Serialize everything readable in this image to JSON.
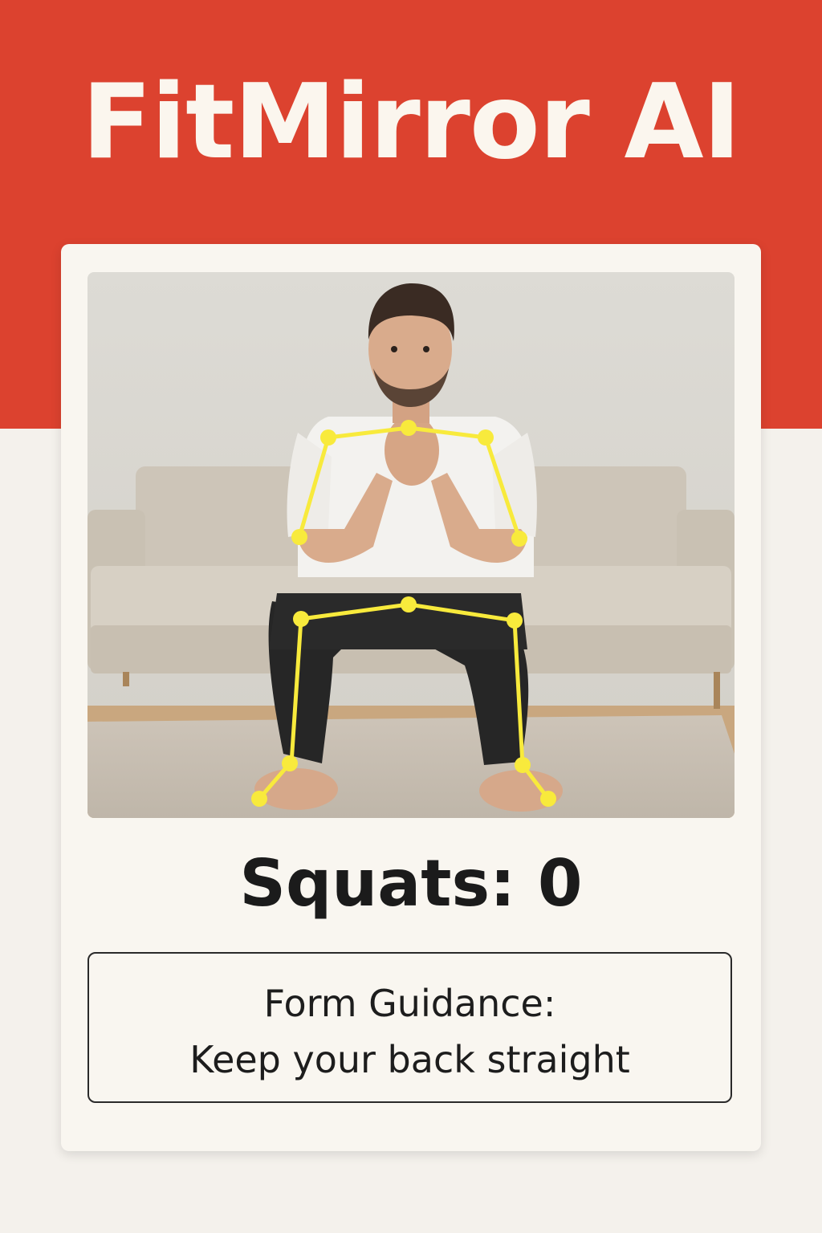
{
  "app": {
    "title": "FitMirror AI"
  },
  "exercise": {
    "counter_label": "Squats: 0",
    "name": "Squats",
    "reps": 0
  },
  "guidance": {
    "heading": "Form Guidance:",
    "tip": "Keep your back straight"
  },
  "camera_feed": {
    "description_icon": "person-photo",
    "overlay_color": "#f8ea3c"
  },
  "colors": {
    "brand_red": "#dc422f",
    "background": "#f4f1ec",
    "card": "#f9f6f0",
    "skeleton": "#f8ea3c"
  }
}
